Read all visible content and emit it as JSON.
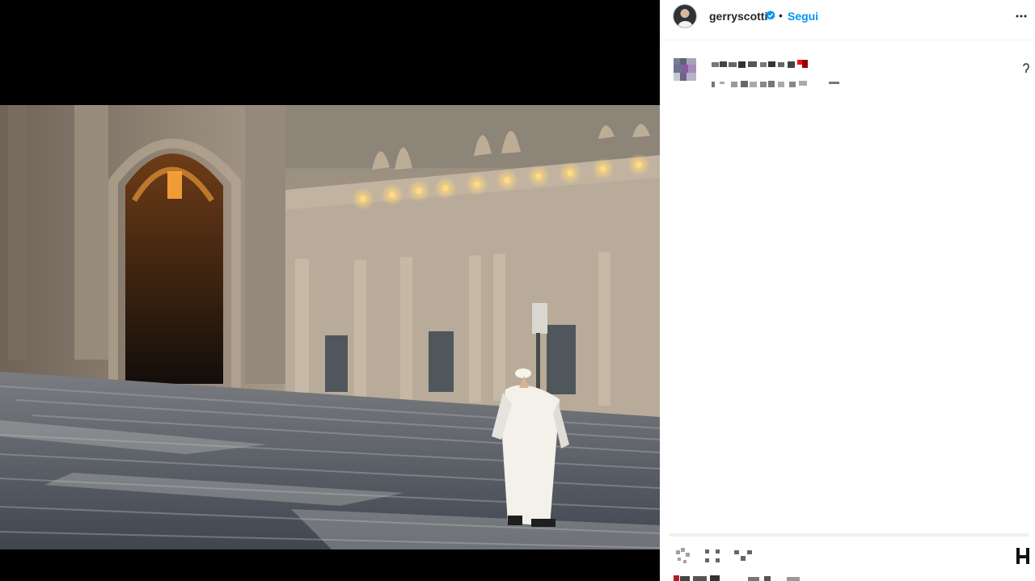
{
  "post": {
    "username": "gerryscotti",
    "follow_label": "Segui",
    "separator": "•",
    "verified": true,
    "more_icon": "more-horizontal-icon",
    "media": {
      "description": "",
      "alt": ""
    }
  },
  "caption": {
    "username_text": "",
    "body_text": ""
  },
  "actions": [
    {
      "name": "like",
      "icon": "heart-icon"
    },
    {
      "name": "comment",
      "icon": "comment-icon"
    },
    {
      "name": "share",
      "icon": "paper-plane-icon"
    },
    {
      "name": "save",
      "icon": "bookmark-icon"
    }
  ],
  "colors": {
    "brand_blue": "#0095f6",
    "text": "#262626",
    "divider": "#efefef",
    "media_background": "#000000"
  }
}
